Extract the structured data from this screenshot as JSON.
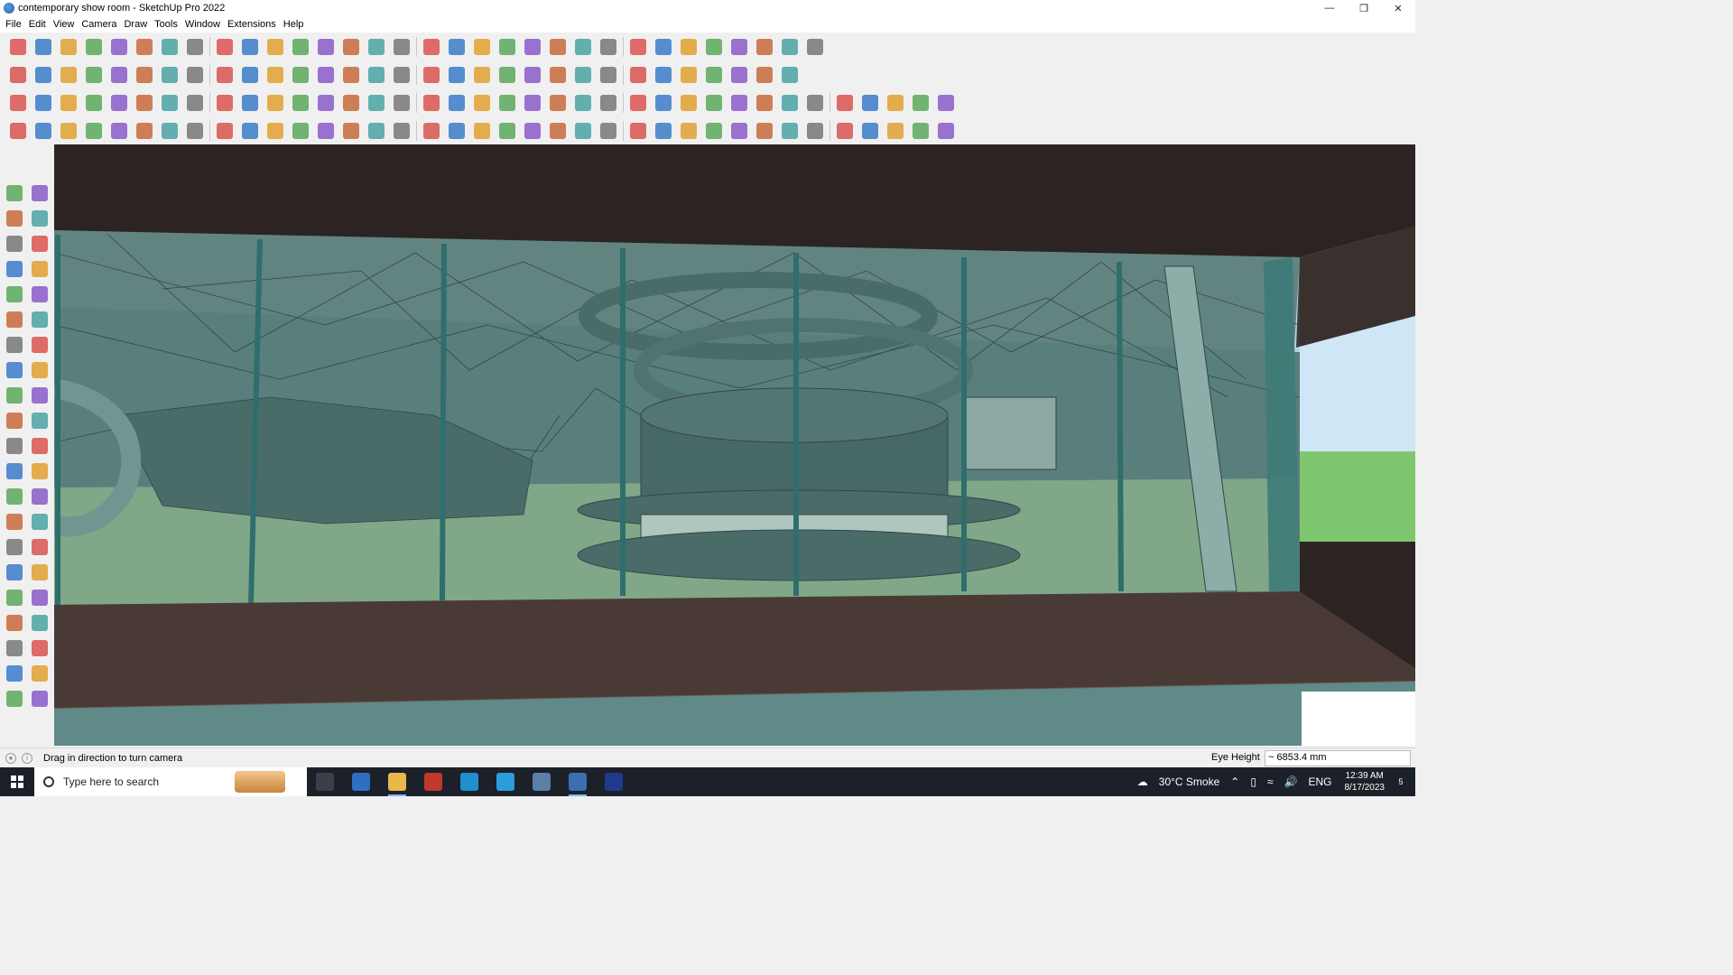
{
  "window": {
    "title": "contemporary show room - SketchUp Pro 2022",
    "controls": [
      "minimize-icon",
      "restore-icon",
      "close-icon"
    ]
  },
  "menu": {
    "items": [
      "File",
      "Edit",
      "View",
      "Camera",
      "Draw",
      "Tools",
      "Window",
      "Extensions",
      "Help"
    ]
  },
  "toolbars": {
    "row1_icons": [
      "zoom-icon",
      "select-icon",
      "eraser-icon",
      "pencil-icon",
      "lasso-icon",
      "paint-icon",
      "push-pull-icon",
      "follow-me-icon",
      "move-icon",
      "rotate-icon",
      "scale-icon",
      "tape-icon",
      "text-icon",
      "paint-bucket-icon",
      "orbit-icon",
      "pan-icon",
      "zoom-window-icon",
      "zoom-extents-icon",
      "warehouse-icon",
      "layers-icon",
      "styles-icon",
      "components-icon",
      "user-icon",
      "section-plane-icon",
      "section-display-icon",
      "axis-icon",
      "flip-icon",
      "import-icon",
      "export-icon",
      "undo-icon",
      "redo-icon",
      "sandbox-icon"
    ],
    "row2_icons": [
      "iso-view-icon",
      "top-view-icon",
      "front-view-icon",
      "right-view-icon",
      "back-view-icon",
      "left-view-icon",
      "bottom-view-icon",
      "xray-icon",
      "wireframe-icon",
      "hidden-line-icon",
      "shaded-icon",
      "textured-icon",
      "monochrome-icon",
      "house-icon",
      "house-outline-icon",
      "warehouse-icon",
      "fx-icon",
      "tag-icon",
      "ruler-icon",
      "circle-icon",
      "polygon-icon",
      "ellipse-icon",
      "parallelogram-icon",
      "arc-icon",
      "spiral-icon",
      "curve-icon",
      "shape-icon",
      "transform-icon",
      "scale-icon",
      "eraser-icon",
      "material-icon"
    ],
    "row3_icons": [
      "component-icon",
      "solid-icon",
      "plane-icon",
      "layer-icon",
      "undo-arrow-icon",
      "square-icon",
      "list-icon",
      "frame-icon",
      "bridge-icon",
      "chain-icon",
      "curve-icon",
      "nodes-icon",
      "cross-icon",
      "plus-icon",
      "scissors-icon",
      "cone-icon",
      "spike-icon",
      "triangle-icon",
      "curl-icon",
      "knot-icon",
      "loop-icon",
      "star-icon",
      "cube-icon",
      "cut-icon",
      "magnet-icon",
      "tree-icon",
      "link-icon",
      "box-icon",
      "sphere-icon",
      "dots-icon",
      "frame-icon",
      "grid-icon",
      "hatch-icon",
      "mark-icon",
      "hook-icon",
      "dotted-icon",
      "relay-icon"
    ],
    "row4_icons": [
      "edge-icon",
      "vertex-icon",
      "shell-icon",
      "tube-icon",
      "brush-icon",
      "twist-icon",
      "shard-icon",
      "corner-icon",
      "corner-icon",
      "line-icon",
      "tilt-icon",
      "box-icon",
      "triangle-icon",
      "pillar-icon",
      "bolt-icon",
      "claw-icon",
      "loop-icon",
      "arrow-icon",
      "fan-icon",
      "slash-icon",
      "strand-icon",
      "strand-icon",
      "strand-icon",
      "grid-icon",
      "arc-icon",
      "hook-icon",
      "grid-icon",
      "grid-icon",
      "grid-icon",
      "grid-icon",
      "grid-icon",
      "grid-icon",
      "grid-icon",
      "grid-icon",
      "grid-icon",
      "grid-icon",
      "grid-icon"
    ]
  },
  "left_toolbar_icons": [
    "select-icon",
    "orbit-icon",
    "paint-bucket-icon",
    "eraser-icon",
    "components-icon",
    "tape-icon",
    "line-icon",
    "freehand-icon",
    "rectangle-icon",
    "rotated-rect-icon",
    "circle-icon",
    "polygon-icon",
    "arc-icon",
    "pie-icon",
    "two-point-arc-icon",
    "three-point-arc-icon",
    "move-icon",
    "push-pull-icon",
    "rotate-icon",
    "follow-me-icon",
    "scale-icon",
    "offset-icon",
    "tape-measure-icon",
    "dimension-icon",
    "protractor-icon",
    "text-icon",
    "axes-icon",
    "3d-text-icon",
    "orbit-icon",
    "pan-icon",
    "zoom-icon",
    "zoom-window-icon",
    "zoom-extents-icon",
    "previous-view-icon",
    "position-camera-icon",
    "look-around-icon",
    "walk-icon",
    "section-plane-icon",
    "section-display-icon",
    "section-cut-icon",
    "layers-icon",
    "styles-icon"
  ],
  "viewport": {
    "colors": {
      "glass": "#5f8f8a",
      "floor": "#8fb08a",
      "ceiling": "#6a8582",
      "slab": "#4a3a36",
      "sky": "#cfe6f7",
      "grass": "#7fc76e"
    }
  },
  "statusbar": {
    "message": "Drag in direction to turn camera",
    "measure_label": "Eye Height",
    "measure_value": "~ 6853.4 mm"
  },
  "taskbar": {
    "search_placeholder": "Type here to search",
    "apps": [
      "task-view-icon",
      "calculator-icon",
      "file-explorer-icon",
      "acrobat-icon",
      "store-icon",
      "edge-icon",
      "snipping-icon",
      "sketchup-icon",
      "photoshop-icon"
    ],
    "weather": "30°C  Smoke",
    "language": "ENG",
    "time": "12:39 AM",
    "date": "8/17/2023",
    "notifications": "5"
  }
}
